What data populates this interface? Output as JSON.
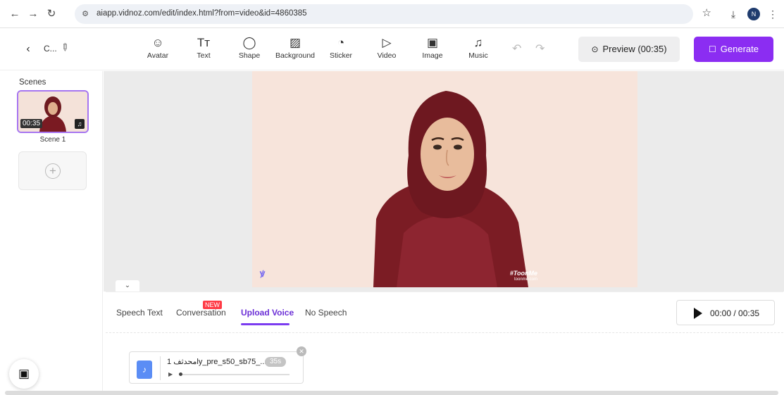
{
  "browser": {
    "url": "aiapp.vidnoz.com/edit/index.html?from=video&id=4860385",
    "profile_initial": "N",
    "icons": [
      "back-arrow-icon",
      "forward-arrow-icon",
      "reload-icon",
      "site-settings-icon",
      "bookmark-star-icon",
      "download-icon",
      "kebab-menu-icon"
    ]
  },
  "toolbar": {
    "project_name": "C...",
    "tools": [
      {
        "label": "Avatar",
        "icon": "☺"
      },
      {
        "label": "Text",
        "icon": "Tт"
      },
      {
        "label": "Shape",
        "icon": "◯"
      },
      {
        "label": "Background",
        "icon": "▨"
      },
      {
        "label": "Sticker",
        "icon": "◔"
      },
      {
        "label": "Video",
        "icon": "▷"
      },
      {
        "label": "Image",
        "icon": "▣"
      },
      {
        "label": "Music",
        "icon": "♫"
      }
    ],
    "preview_label": "Preview (00:35)",
    "generate_label": "Generate"
  },
  "scenes": {
    "title": "Scenes",
    "items": [
      {
        "label": "Scene 1",
        "duration": "00:35"
      }
    ]
  },
  "canvas": {
    "background_color": "#f7e4db",
    "watermark_tag": "#ToonMe",
    "watermark_site": "toonme.com"
  },
  "speech": {
    "tabs": [
      "Speech Text",
      "Conversation",
      "Upload Voice",
      "No Speech"
    ],
    "active_tab": "Upload Voice",
    "new_badge": "NEW",
    "player_time": "00:00 / 00:35",
    "voice_file": {
      "name": "1 محدثفly_pre_s50_sb75_...",
      "duration": "35s"
    }
  },
  "colors": {
    "accent": "#8b2df2",
    "active_tab": "#6b2fd6"
  }
}
